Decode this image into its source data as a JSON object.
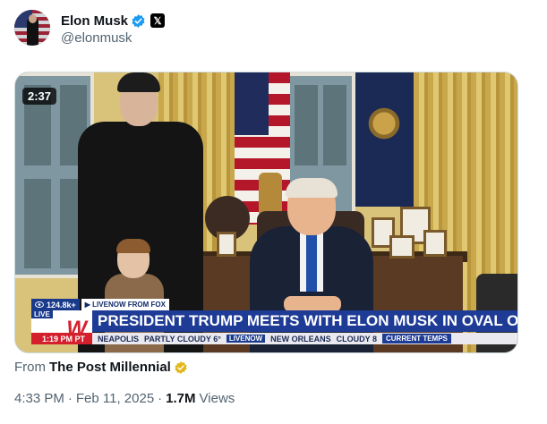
{
  "author": {
    "display_name": "Elon Musk",
    "handle": "@elonmusk",
    "x_badge": "𝕏",
    "verified_color": "#1d9bf0",
    "icons": {
      "verified": "verified-badge-icon",
      "platform": "x-logo-icon"
    }
  },
  "video": {
    "duration": "2:37",
    "overlay": {
      "views": "124.8k+",
      "source_tag": "▶ LIVENOW FROM FOX",
      "live_label": "LIVE",
      "logo_letter": "W",
      "headline": "PRESIDENT TRUMP MEETS WITH ELON MUSK IN OVAL OFFICE",
      "time": "1:19 PM PT",
      "weather": [
        {
          "city": "NEAPOLIS",
          "condition": "PARTLY CLOUDY 6°"
        },
        {
          "city": "NEW ORLEANS",
          "condition": "CLOUDY 8"
        }
      ],
      "weather_logo": "LIVENOW",
      "current_temps": "CURRENT TEMPS"
    }
  },
  "source": {
    "prefix": "From",
    "name": "The Post Millennial",
    "badge_color": "#e2b719"
  },
  "meta": {
    "time": "4:33 PM",
    "date": "Feb 11, 2025",
    "separator": "·",
    "views_count": "1.7M",
    "views_label": "Views"
  }
}
